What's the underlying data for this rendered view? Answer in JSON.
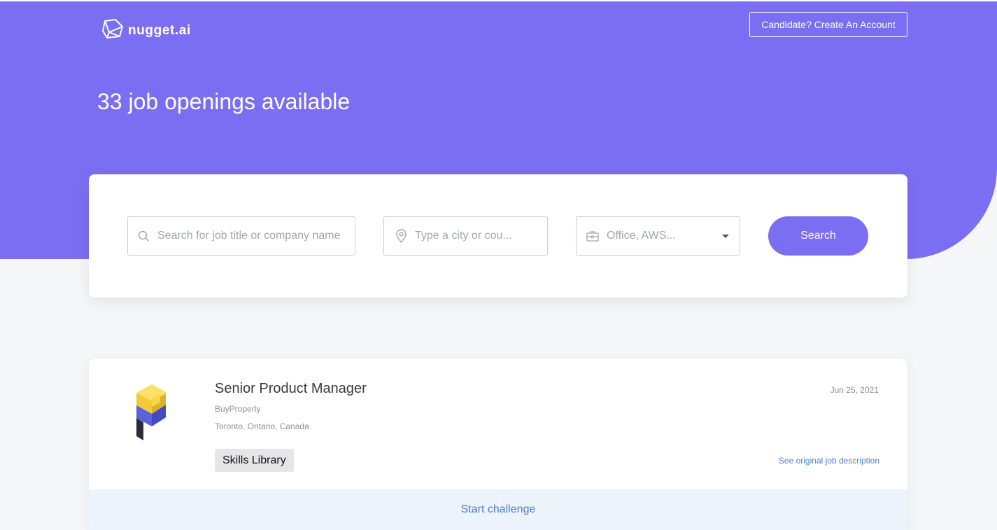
{
  "header": {
    "logo_text": "nugget.ai",
    "account_button": "Candidate? Create An Account",
    "headline": "33 job openings available"
  },
  "search": {
    "keyword_placeholder": "Search for job title or company name",
    "location_placeholder": "Type a city or cou...",
    "workplace_value": "Office, AWS...",
    "button_label": "Search"
  },
  "jobs": [
    {
      "title": "Senior Product Manager",
      "company": "BuyProperly",
      "location": "Toronto, Ontario, Canada",
      "date": "Jun 25, 2021",
      "tag": "Skills Library",
      "link_label": "See original job description",
      "cta_label": "Start challenge"
    }
  ],
  "colors": {
    "brand": "#7b6ef2",
    "link": "#4a7fcf",
    "cta_background": "#ecf3fb"
  },
  "icons": [
    "nugget-logo-icon",
    "search-icon",
    "location-pin-icon",
    "briefcase-icon",
    "chevron-down-icon",
    "buyproperly-logo"
  ]
}
